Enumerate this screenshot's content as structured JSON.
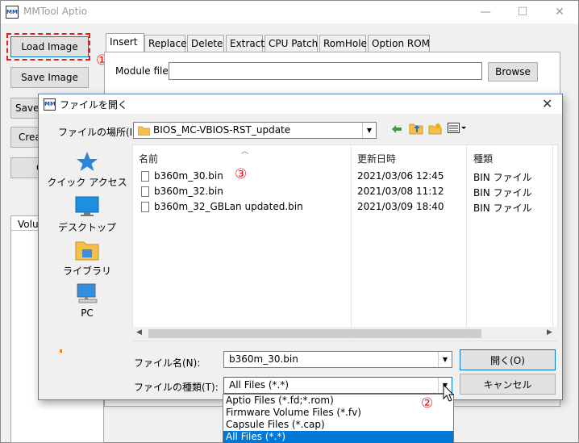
{
  "app": {
    "title": "MMTool Aptio",
    "icon_text": "MM",
    "minimize_glyph": "—",
    "maximize_glyph": "☐",
    "close_glyph": "✕"
  },
  "left_buttons": {
    "load_image": "Load Image",
    "save_image": "Save Image",
    "save_partial": "Save",
    "create_partial": "Crea",
    "third_partial": "C"
  },
  "tabs": [
    "Insert",
    "Replace",
    "Delete",
    "Extract",
    "CPU Patch",
    "RomHole",
    "Option ROM"
  ],
  "insert_panel": {
    "module_file_label": "Module file",
    "browse_label": "Browse"
  },
  "volume_grid": {
    "header": "Volu"
  },
  "dialog": {
    "title": "ファイルを開く",
    "icon_text": "MM",
    "close_glyph": "✕",
    "look_in_label": "ファイルの場所(I):",
    "look_in_value": "BIOS_MC-VBIOS-RST_update",
    "toolbar_icons": [
      "back-arrow-icon",
      "up-folder-icon",
      "new-folder-icon",
      "view-menu-icon"
    ],
    "places": [
      {
        "label": "クイック アクセス",
        "icon": "quick-access-star-icon"
      },
      {
        "label": "デスクトップ",
        "icon": "desktop-icon"
      },
      {
        "label": "ライブラリ",
        "icon": "library-icon"
      },
      {
        "label": "PC",
        "icon": "pc-icon"
      }
    ],
    "columns": {
      "name": "名前",
      "date": "更新日時",
      "type": "種類"
    },
    "files": [
      {
        "name": "b360m_30.bin",
        "date": "2021/03/06 12:45",
        "type": "BIN ファイル"
      },
      {
        "name": "b360m_32.bin",
        "date": "2021/03/08 11:12",
        "type": "BIN ファイル"
      },
      {
        "name": "b360m_32_GBLan updated.bin",
        "date": "2021/03/09 18:40",
        "type": "BIN ファイル"
      }
    ],
    "filename_label": "ファイル名(N):",
    "filename_value": "b360m_30.bin",
    "filetype_label": "ファイルの種類(T):",
    "filetype_value": "All Files (*.*)",
    "open_button": "開く(O)",
    "cancel_button": "キャンセル",
    "filetype_options": [
      "Aptio Files (*.fd;*.rom)",
      "Firmware Volume Files (*.fv)",
      "Capsule Files (*.cap)",
      "All Files (*.*)"
    ],
    "selected_option_index": 3
  },
  "annotations": {
    "marker1": "①",
    "marker2": "②",
    "marker3": "③"
  },
  "colors": {
    "highlight": "#0078d7",
    "marker_red": "#e02020"
  }
}
